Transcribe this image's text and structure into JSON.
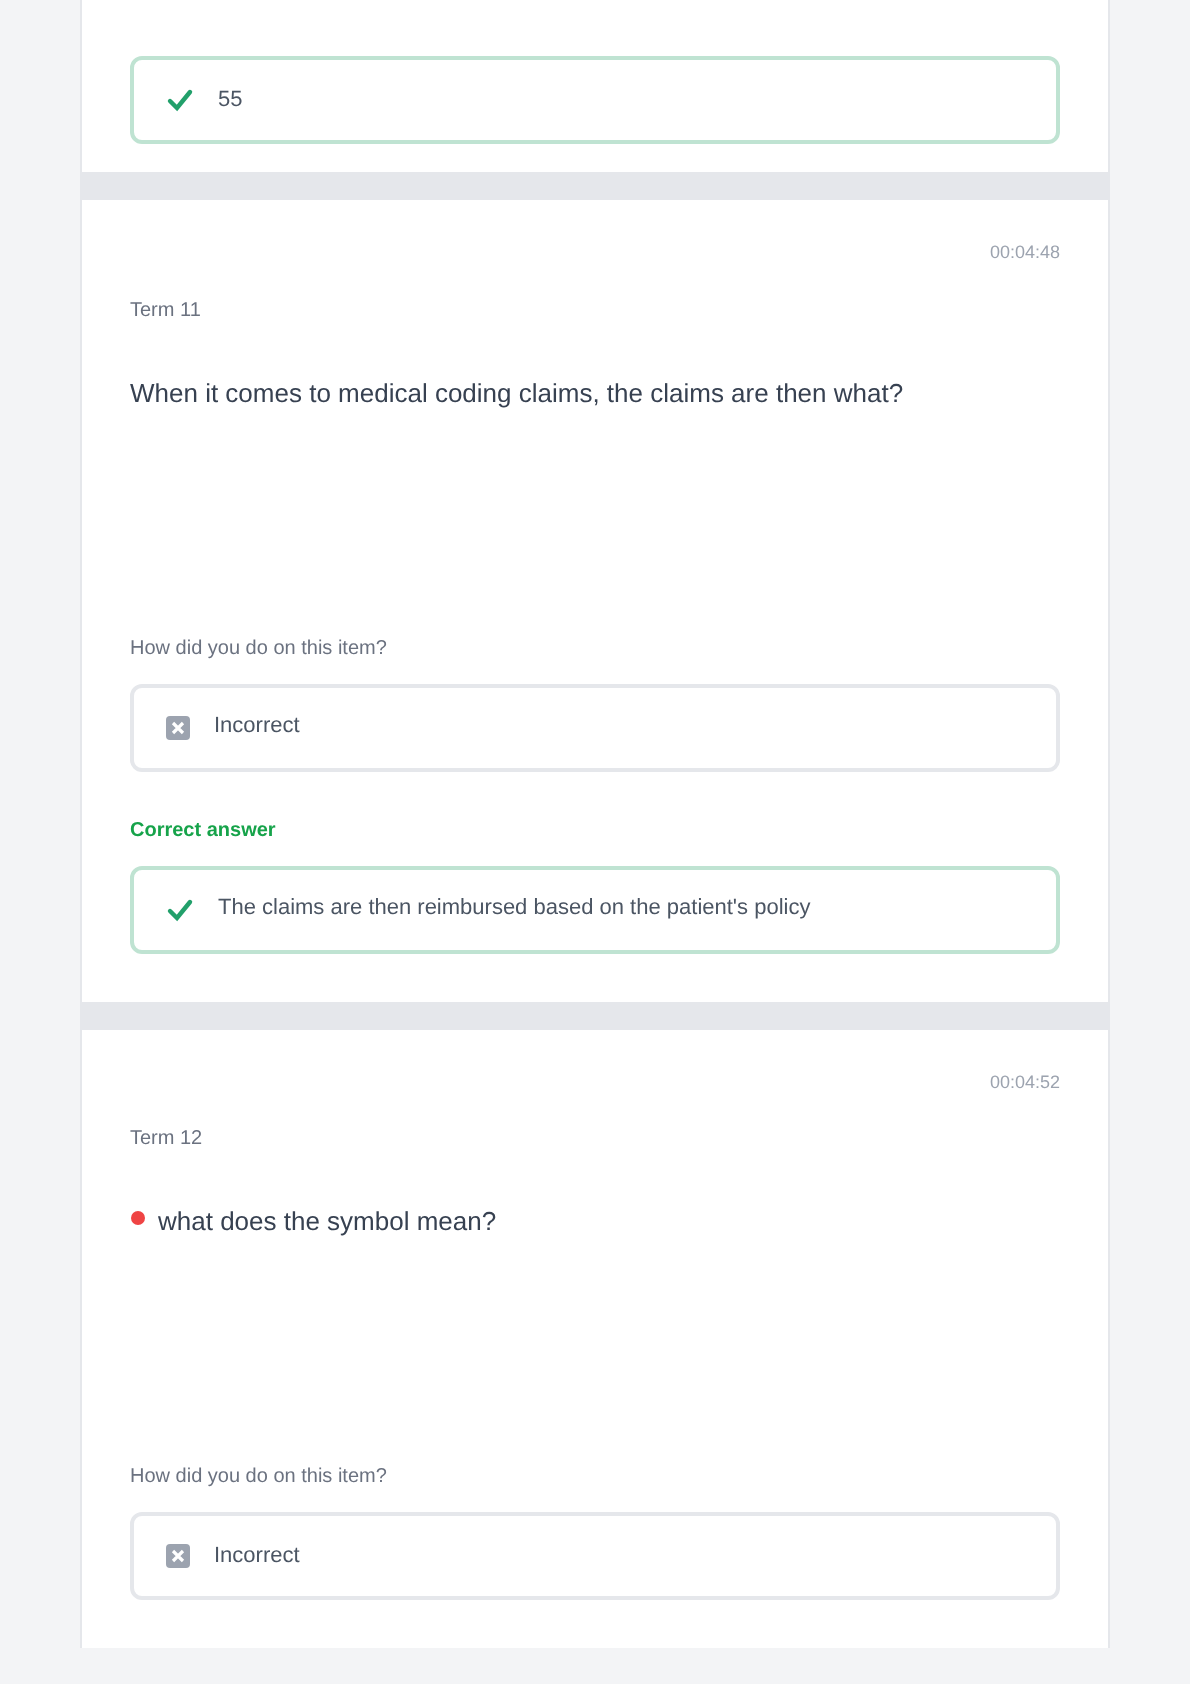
{
  "cards": [
    {
      "answers": [
        {
          "kind": "correct",
          "text": "55"
        }
      ]
    },
    {
      "time": "00:04:48",
      "term": "Term 11",
      "question": "When it comes to medical coding claims, the claims are then what?",
      "prompt": "How did you do on this item?",
      "answers": [
        {
          "kind": "incorrect",
          "text": "Incorrect"
        }
      ],
      "correct_label": "Correct answer",
      "correct_answers": [
        {
          "kind": "correct",
          "text": "The claims are then reimbursed based on the patient's policy"
        }
      ]
    },
    {
      "time": "00:04:52",
      "term": "Term 12",
      "question": "what does the symbol mean?",
      "flagged": true,
      "prompt": "How did you do on this item?",
      "answers": [
        {
          "kind": "incorrect",
          "text": "Incorrect"
        }
      ]
    }
  ]
}
